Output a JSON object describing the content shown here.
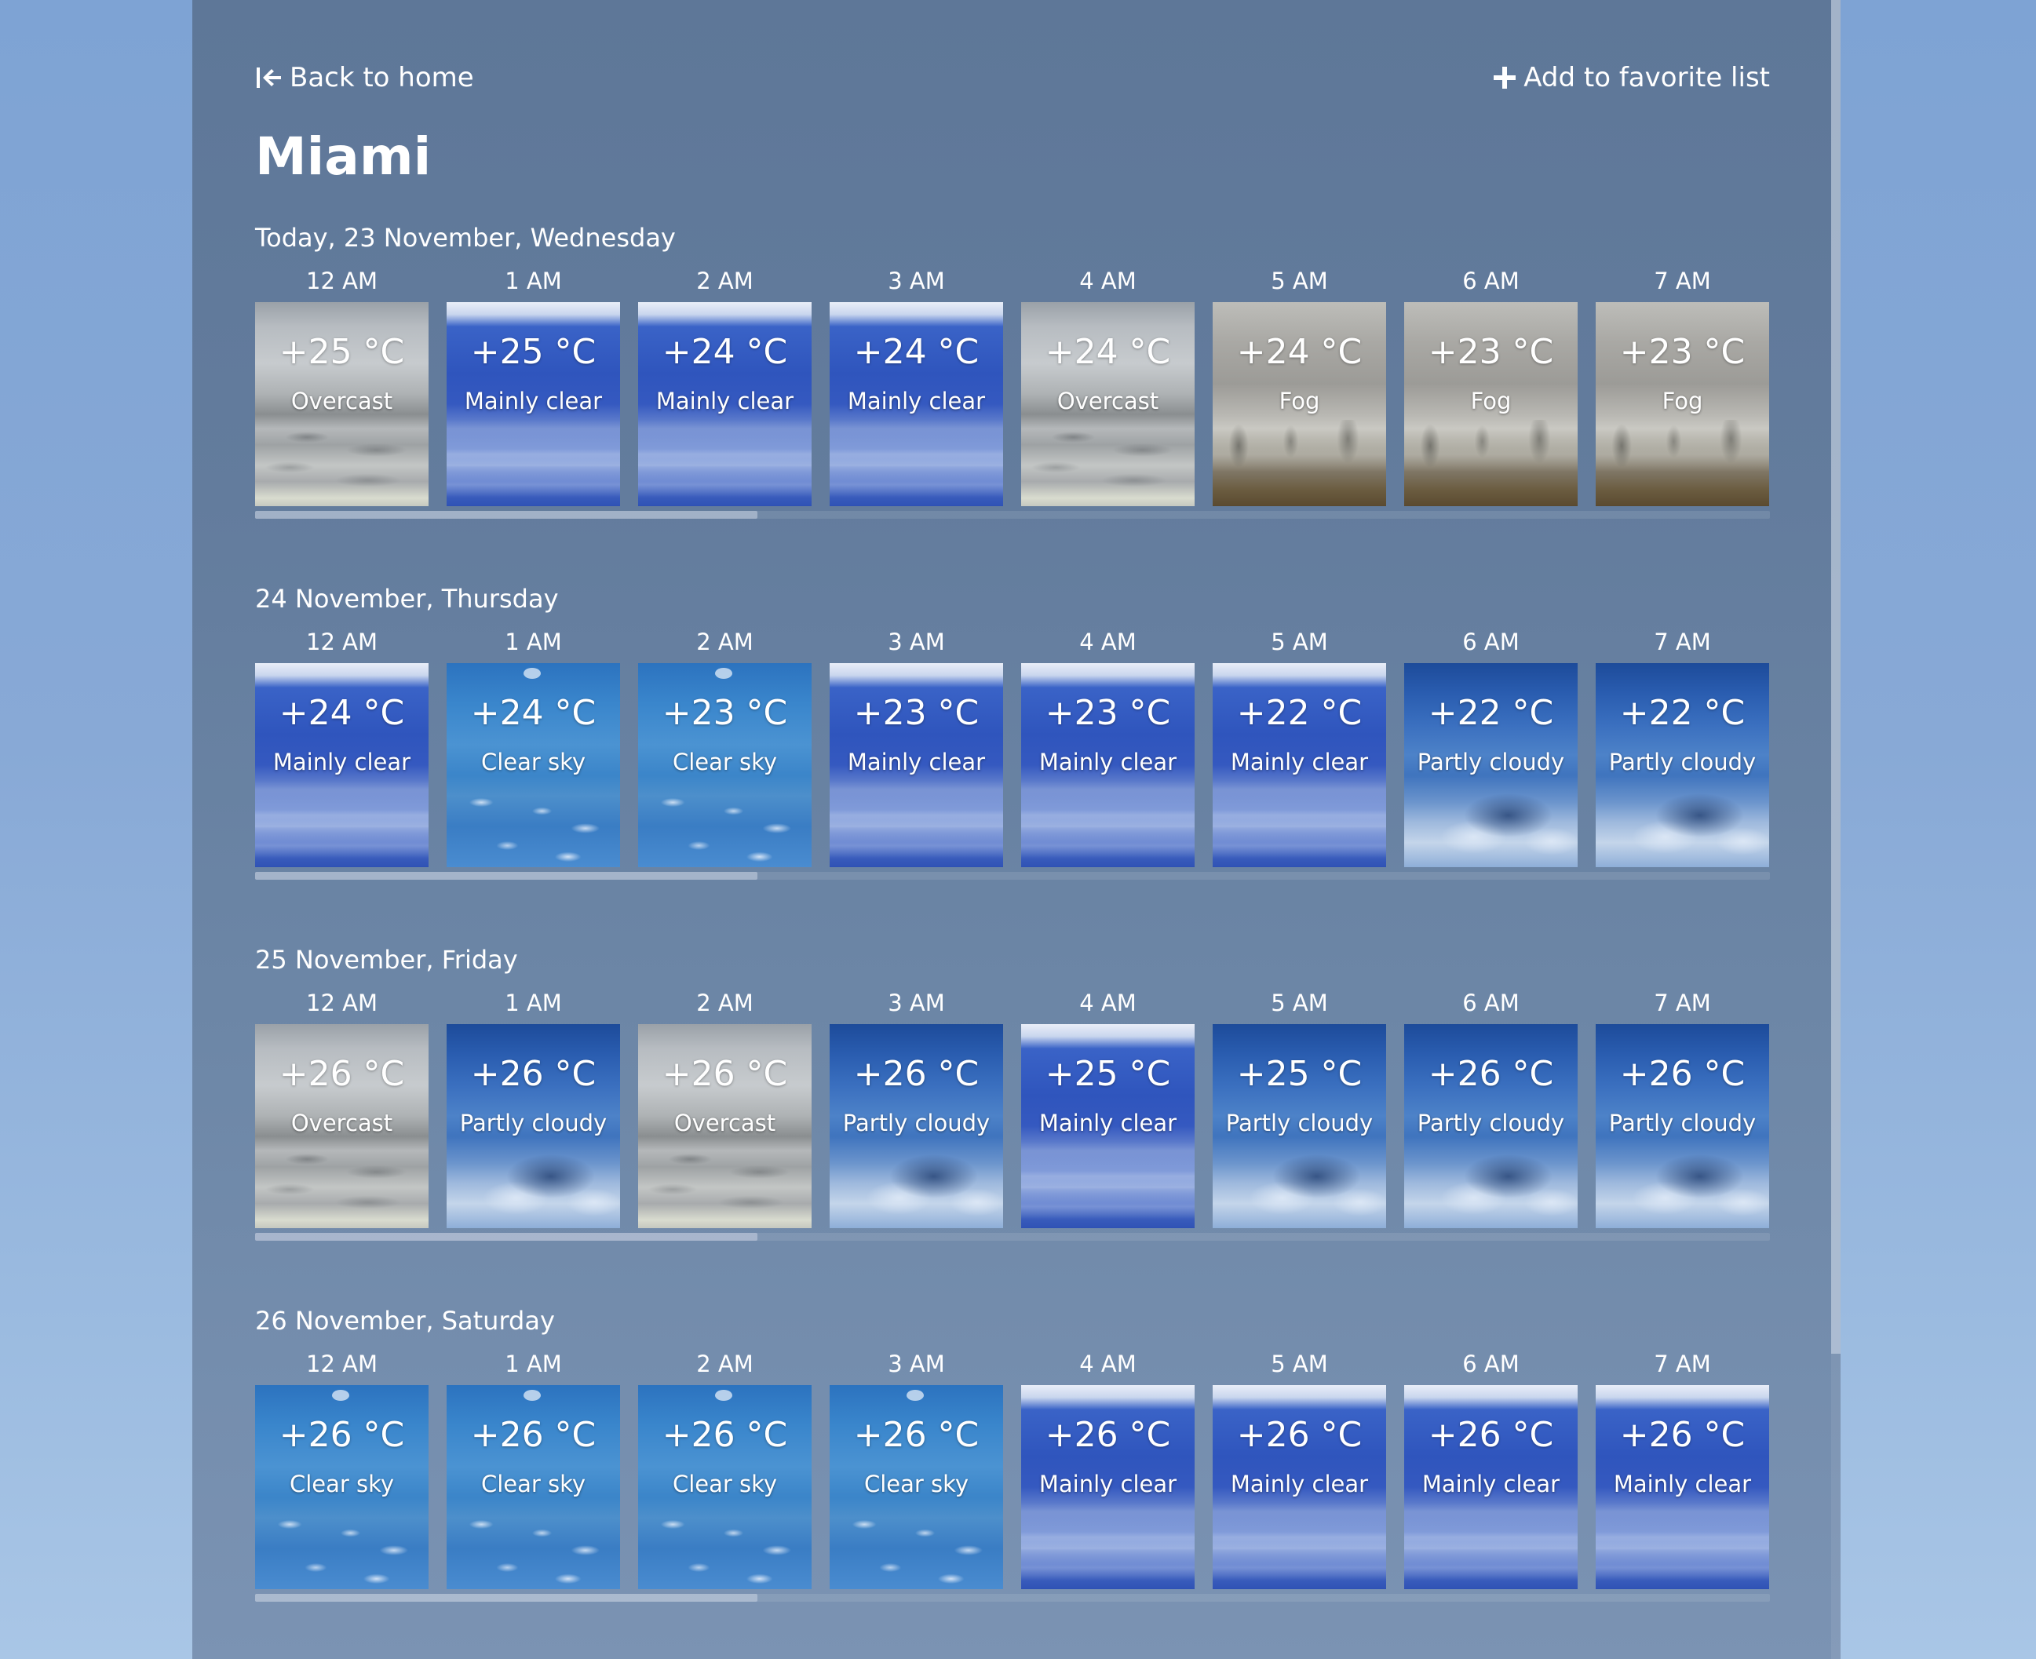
{
  "colors": {
    "background_top": "#7ea3d4",
    "panel": "#637c9d",
    "text": "#ffffff"
  },
  "nav": {
    "back_label": "Back to home",
    "back_icon": "arrow-left-to-line-icon",
    "favorite_label": "Add to favorite list",
    "favorite_icon": "plus-icon"
  },
  "city": "Miami",
  "days": [
    {
      "label": "Today, 23 November, Wednesday",
      "hours": [
        {
          "time": "12 AM",
          "temp": "+25 °C",
          "desc": "Overcast",
          "kind": "overcast"
        },
        {
          "time": "1 AM",
          "temp": "+25 °C",
          "desc": "Mainly clear",
          "kind": "mainly"
        },
        {
          "time": "2 AM",
          "temp": "+24 °C",
          "desc": "Mainly clear",
          "kind": "mainly"
        },
        {
          "time": "3 AM",
          "temp": "+24 °C",
          "desc": "Mainly clear",
          "kind": "mainly"
        },
        {
          "time": "4 AM",
          "temp": "+24 °C",
          "desc": "Overcast",
          "kind": "overcast"
        },
        {
          "time": "5 AM",
          "temp": "+24 °C",
          "desc": "Fog",
          "kind": "fog"
        },
        {
          "time": "6 AM",
          "temp": "+23 °C",
          "desc": "Fog",
          "kind": "fog"
        },
        {
          "time": "7 AM",
          "temp": "+23 °C",
          "desc": "Fog",
          "kind": "fog"
        }
      ]
    },
    {
      "label": "24 November, Thursday",
      "hours": [
        {
          "time": "12 AM",
          "temp": "+24 °C",
          "desc": "Mainly clear",
          "kind": "mainly"
        },
        {
          "time": "1 AM",
          "temp": "+24 °C",
          "desc": "Clear sky",
          "kind": "clear"
        },
        {
          "time": "2 AM",
          "temp": "+23 °C",
          "desc": "Clear sky",
          "kind": "clear"
        },
        {
          "time": "3 AM",
          "temp": "+23 °C",
          "desc": "Mainly clear",
          "kind": "mainly"
        },
        {
          "time": "4 AM",
          "temp": "+23 °C",
          "desc": "Mainly clear",
          "kind": "mainly"
        },
        {
          "time": "5 AM",
          "temp": "+22 °C",
          "desc": "Mainly clear",
          "kind": "mainly"
        },
        {
          "time": "6 AM",
          "temp": "+22 °C",
          "desc": "Partly cloudy",
          "kind": "partly"
        },
        {
          "time": "7 AM",
          "temp": "+22 °C",
          "desc": "Partly cloudy",
          "kind": "partly"
        }
      ]
    },
    {
      "label": "25 November, Friday",
      "hours": [
        {
          "time": "12 AM",
          "temp": "+26 °C",
          "desc": "Overcast",
          "kind": "overcast"
        },
        {
          "time": "1 AM",
          "temp": "+26 °C",
          "desc": "Partly cloudy",
          "kind": "partly"
        },
        {
          "time": "2 AM",
          "temp": "+26 °C",
          "desc": "Overcast",
          "kind": "overcast"
        },
        {
          "time": "3 AM",
          "temp": "+26 °C",
          "desc": "Partly cloudy",
          "kind": "partly"
        },
        {
          "time": "4 AM",
          "temp": "+25 °C",
          "desc": "Mainly clear",
          "kind": "mainly"
        },
        {
          "time": "5 AM",
          "temp": "+25 °C",
          "desc": "Partly cloudy",
          "kind": "partly"
        },
        {
          "time": "6 AM",
          "temp": "+26 °C",
          "desc": "Partly cloudy",
          "kind": "partly"
        },
        {
          "time": "7 AM",
          "temp": "+26 °C",
          "desc": "Partly cloudy",
          "kind": "partly"
        }
      ]
    },
    {
      "label": "26 November, Saturday",
      "hours": [
        {
          "time": "12 AM",
          "temp": "+26 °C",
          "desc": "Clear sky",
          "kind": "clear"
        },
        {
          "time": "1 AM",
          "temp": "+26 °C",
          "desc": "Clear sky",
          "kind": "clear"
        },
        {
          "time": "2 AM",
          "temp": "+26 °C",
          "desc": "Clear sky",
          "kind": "clear"
        },
        {
          "time": "3 AM",
          "temp": "+26 °C",
          "desc": "Clear sky",
          "kind": "clear"
        },
        {
          "time": "4 AM",
          "temp": "+26 °C",
          "desc": "Mainly clear",
          "kind": "mainly"
        },
        {
          "time": "5 AM",
          "temp": "+26 °C",
          "desc": "Mainly clear",
          "kind": "mainly"
        },
        {
          "time": "6 AM",
          "temp": "+26 °C",
          "desc": "Mainly clear",
          "kind": "mainly"
        },
        {
          "time": "7 AM",
          "temp": "+26 °C",
          "desc": "Mainly clear",
          "kind": "mainly"
        }
      ]
    }
  ]
}
